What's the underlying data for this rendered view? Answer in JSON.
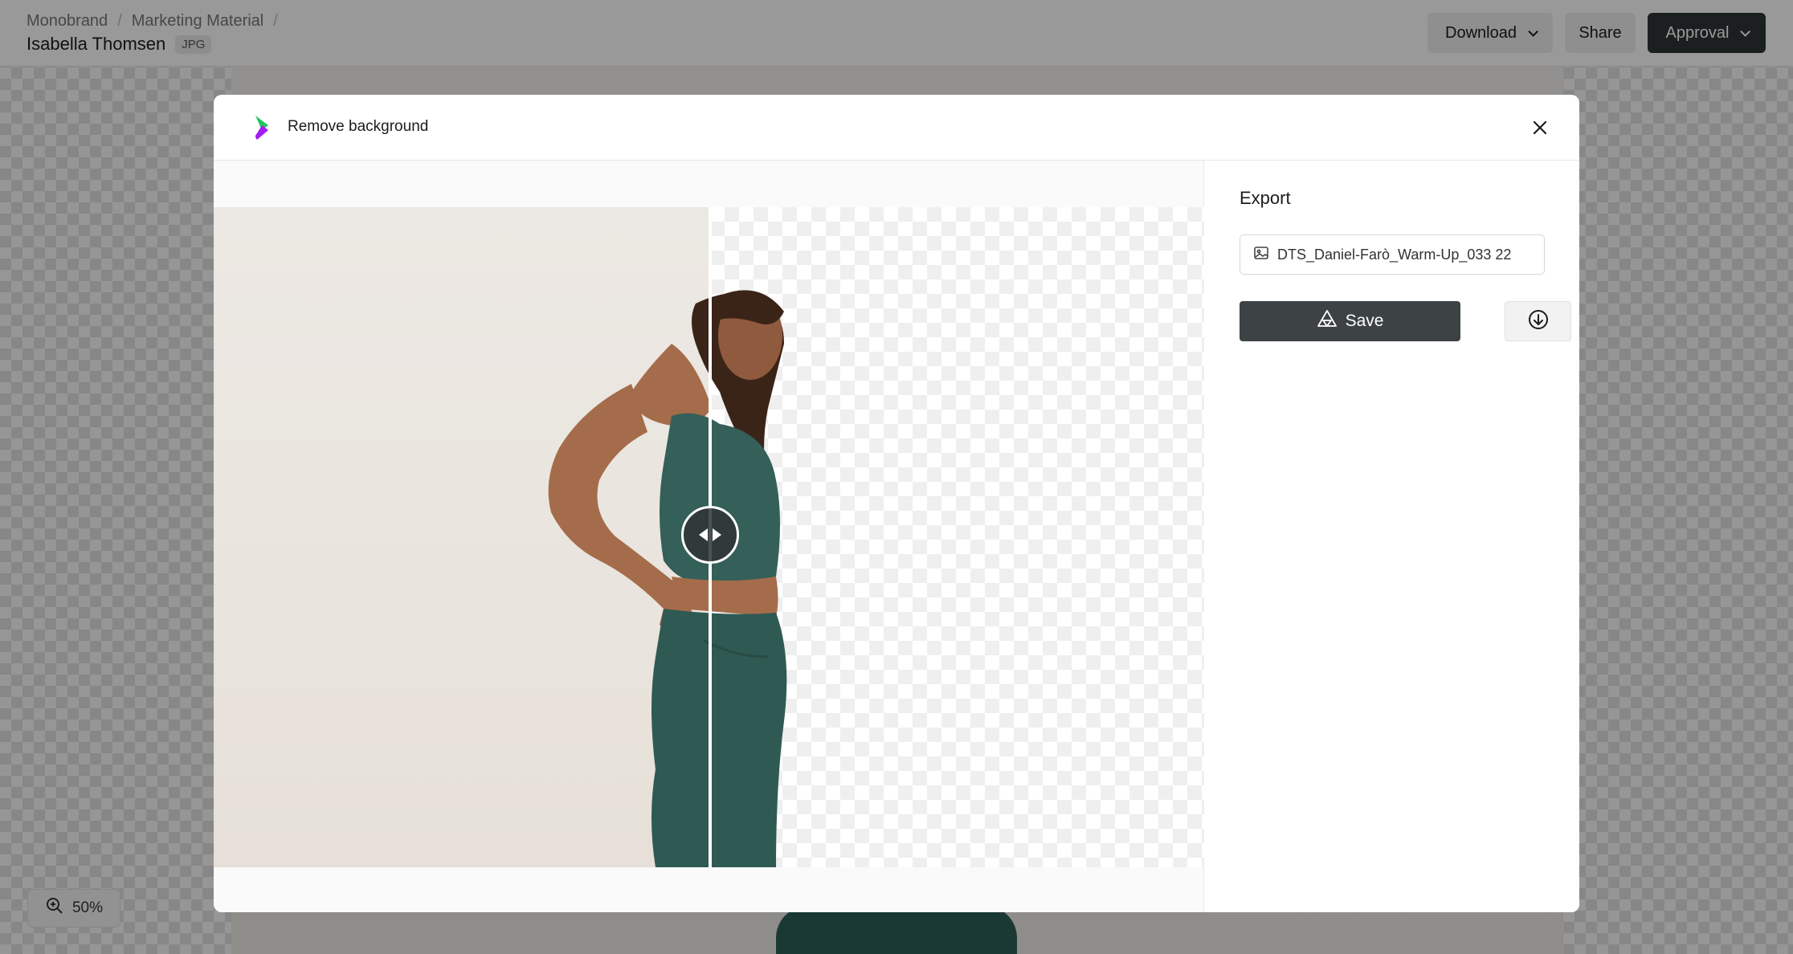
{
  "header": {
    "breadcrumb": [
      "Monobrand",
      "Marketing Material"
    ],
    "title": "Isabella  Thomsen",
    "file_type": "JPG",
    "download_label": "Download",
    "share_label": "Share",
    "approval_label": "Approval"
  },
  "zoom": {
    "level": "50%",
    "icon": "zoom-in-icon"
  },
  "modal": {
    "title": "Remove background",
    "close_icon": "close-icon",
    "compare_split": 0.5
  },
  "export": {
    "title": "Export",
    "filename": "DTS_Daniel-Farò_Warm-Up_033 22",
    "save_label": "Save",
    "download_icon": "download-circle-icon"
  },
  "colors": {
    "primary_dark": "#2f3436",
    "save_button": "#3d4244",
    "logo_green": "#22c55e",
    "logo_purple": "#a21cf5"
  }
}
